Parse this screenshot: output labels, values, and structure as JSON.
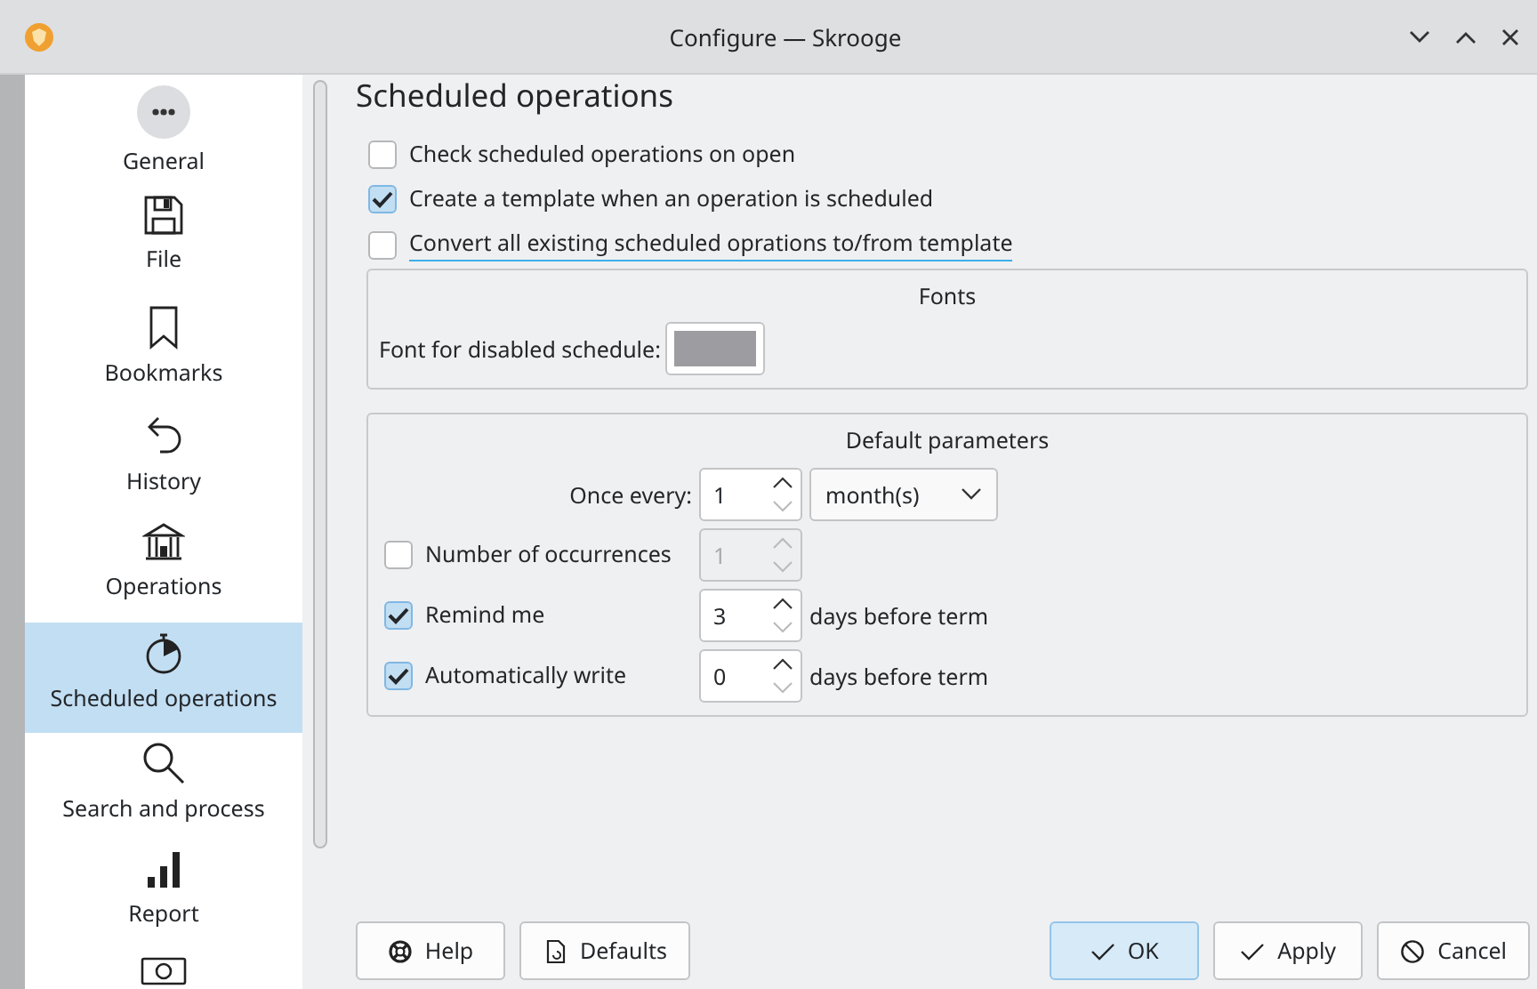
{
  "window": {
    "title": "Configure — Skrooge"
  },
  "sidebar": {
    "items": [
      {
        "label": "General",
        "selected": false
      },
      {
        "label": "File",
        "selected": false
      },
      {
        "label": "Bookmarks",
        "selected": false
      },
      {
        "label": "History",
        "selected": false
      },
      {
        "label": "Operations",
        "selected": false
      },
      {
        "label": "Scheduled operations",
        "selected": true
      },
      {
        "label": "Search and process",
        "selected": false
      },
      {
        "label": "Report",
        "selected": false
      },
      {
        "selected": false
      }
    ]
  },
  "page": {
    "title": "Scheduled operations",
    "options": [
      {
        "label": "Check scheduled operations on open",
        "checked": false,
        "focused": false
      },
      {
        "label": "Create a template when an operation is scheduled",
        "checked": true,
        "focused": false
      },
      {
        "label": "Convert all existing scheduled oprations to/from template",
        "checked": false,
        "focused": true
      }
    ],
    "fonts": {
      "title": "Fonts",
      "label": "Font for disabled schedule:"
    },
    "defaults": {
      "title": "Default parameters",
      "once_every": {
        "label": "Once every:",
        "value": "1",
        "unit": "month(s)"
      },
      "rows": [
        {
          "label": "Number of occurrences",
          "checked": false,
          "value": "1",
          "disabled": true
        },
        {
          "label": "Remind me",
          "checked": true,
          "value": "3",
          "disabled": false,
          "suffix": "days before term"
        },
        {
          "label": "Automatically write",
          "checked": true,
          "value": "0",
          "disabled": false,
          "suffix": "days before term"
        }
      ]
    }
  },
  "buttons": [
    {
      "label": "Help",
      "default": false
    },
    {
      "label": "Defaults",
      "default": false
    },
    {
      "label": "OK",
      "default": true
    },
    {
      "label": "Apply",
      "default": false
    },
    {
      "label": "Cancel",
      "default": false
    }
  ]
}
